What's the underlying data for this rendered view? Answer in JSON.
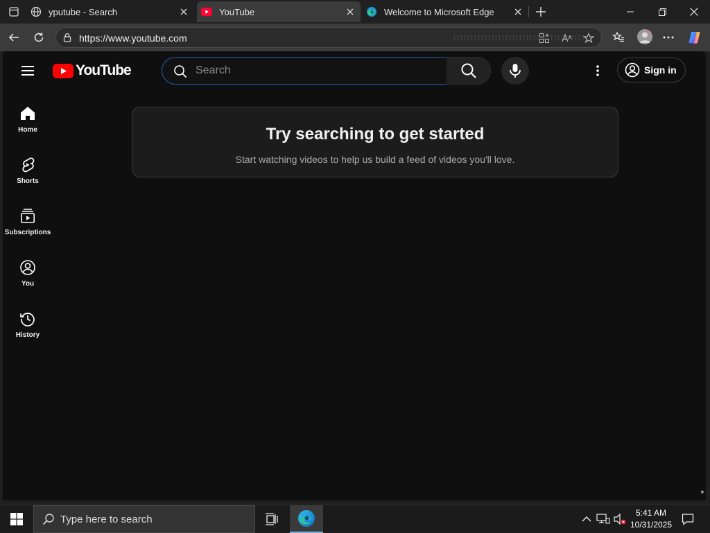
{
  "browser": {
    "tabs": [
      {
        "title": "yputube - Search",
        "favicon": "globe-icon",
        "active": false
      },
      {
        "title": "YouTube",
        "favicon": "youtube-favicon",
        "active": true
      },
      {
        "title": "Welcome to Microsoft Edge",
        "favicon": "edge-icon",
        "active": false
      }
    ],
    "url": "https://www.youtube.com"
  },
  "youtube": {
    "logo_text": "YouTube",
    "search_placeholder": "Search",
    "signin_label": "Sign in",
    "guide": [
      {
        "label": "Home",
        "icon": "home-icon"
      },
      {
        "label": "Shorts",
        "icon": "shorts-icon"
      },
      {
        "label": "Subscriptions",
        "icon": "subscriptions-icon"
      },
      {
        "label": "You",
        "icon": "you-icon"
      },
      {
        "label": "History",
        "icon": "history-icon"
      }
    ],
    "feed": {
      "heading": "Try searching to get started",
      "subtext": "Start watching videos to help us build a feed of videos you'll love."
    },
    "brand_color": "#ff0000",
    "accent_color": "#1c62b9"
  },
  "taskbar": {
    "search_placeholder": "Type here to search",
    "time": "5:41 AM",
    "date": "10/31/2025"
  }
}
